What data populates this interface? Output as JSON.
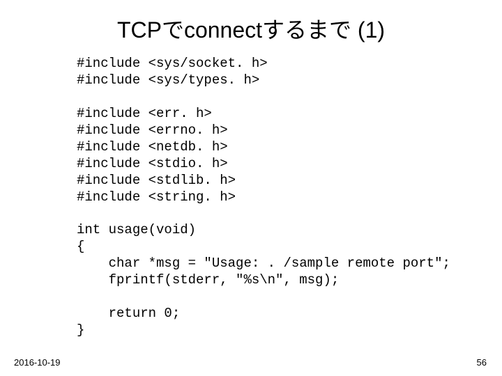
{
  "title": "TCPでconnectするまで (1)",
  "code": "#include <sys/socket. h>\n#include <sys/types. h>\n\n#include <err. h>\n#include <errno. h>\n#include <netdb. h>\n#include <stdio. h>\n#include <stdlib. h>\n#include <string. h>\n\nint usage(void)\n{\n    char *msg = \"Usage: . /sample remote port\";\n    fprintf(stderr, \"%s\\n\", msg);\n\n    return 0;\n}",
  "footer": {
    "date": "2016-10-19",
    "page": "56"
  }
}
